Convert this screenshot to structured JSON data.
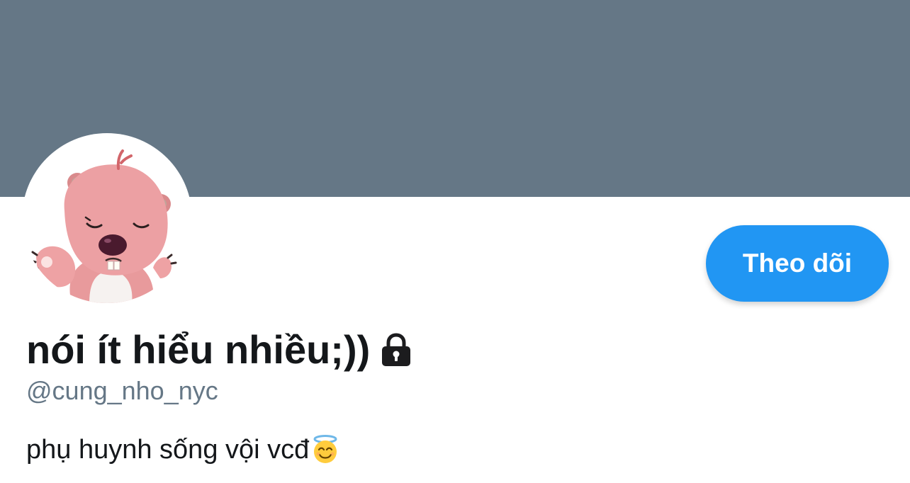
{
  "profile": {
    "display_name": "nói ít hiểu nhiều;))",
    "handle": "@cung_nho_nyc",
    "bio_text": "phụ huynh sống vội vcđ",
    "bio_emoji_icon": "smiling-face-with-halo-icon",
    "protected_icon": "lock-icon",
    "avatar_icon": "beaver-avatar"
  },
  "actions": {
    "follow_label": "Theo dõi"
  },
  "colors": {
    "banner": "#657786",
    "accent": "#2196f3",
    "text_primary": "#14171a",
    "text_secondary": "#657786"
  }
}
